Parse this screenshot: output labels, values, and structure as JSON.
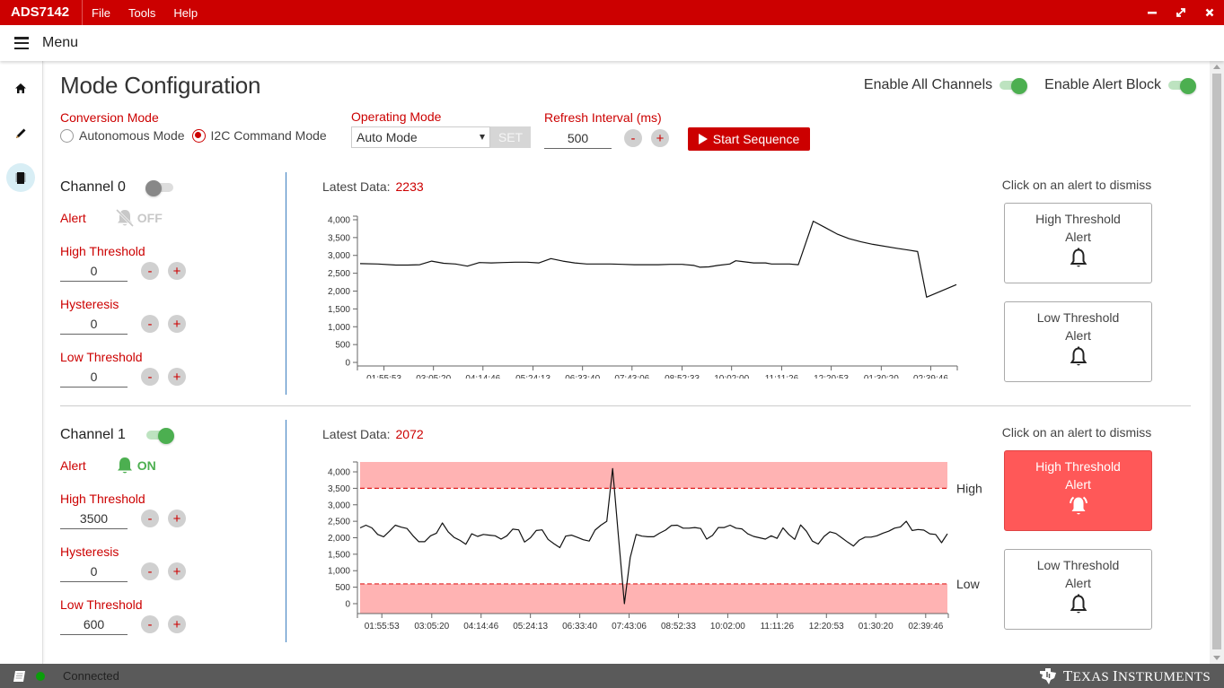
{
  "window": {
    "app_name": "ADS7142",
    "menus": [
      "File",
      "Tools",
      "Help"
    ],
    "controls": {
      "minimize": "minimize-icon",
      "maximize": "maximize-icon",
      "close": "close-icon"
    }
  },
  "menubar": {
    "label": "Menu"
  },
  "sidenav": {
    "items": [
      {
        "icon": "home-icon",
        "active": false
      },
      {
        "icon": "pencil-icon",
        "active": false
      },
      {
        "icon": "chip-icon",
        "active": true
      }
    ]
  },
  "page": {
    "title": "Mode Configuration",
    "enable_all_channels": {
      "label": "Enable All Channels",
      "on": true
    },
    "enable_alert_block": {
      "label": "Enable Alert Block",
      "on": true
    },
    "conversion_mode": {
      "label": "Conversion Mode",
      "options": [
        "Autonomous Mode",
        "I2C Command Mode"
      ],
      "selected": "I2C Command Mode"
    },
    "operating_mode": {
      "label": "Operating Mode",
      "value": "Auto Mode",
      "set_label": "SET"
    },
    "refresh_interval": {
      "label": "Refresh Interval (ms)",
      "value": "500",
      "minus": "-",
      "plus": "+"
    },
    "start_sequence_label": "Start Sequence"
  },
  "channels": [
    {
      "title": "Channel 0",
      "enabled": false,
      "alert_label": "Alert",
      "alert_state": "OFF",
      "high_threshold": {
        "label": "High Threshold",
        "value": "0"
      },
      "hysteresis": {
        "label": "Hysteresis",
        "value": "0"
      },
      "low_threshold": {
        "label": "Low Threshold",
        "value": "0"
      },
      "latest_label": "Latest Data:",
      "latest_value": "2233",
      "alerts_hint": "Click on an alert to dismiss",
      "alerts": [
        {
          "line1": "High Threshold",
          "line2": "Alert",
          "active": false
        },
        {
          "line1": "Low Threshold",
          "line2": "Alert",
          "active": false
        }
      ]
    },
    {
      "title": "Channel 1",
      "enabled": true,
      "alert_label": "Alert",
      "alert_state": "ON",
      "high_threshold": {
        "label": "High Threshold",
        "value": "3500"
      },
      "hysteresis": {
        "label": "Hysteresis",
        "value": "0"
      },
      "low_threshold": {
        "label": "Low Threshold",
        "value": "600"
      },
      "latest_label": "Latest Data:",
      "latest_value": "2072",
      "alerts_hint": "Click on an alert to dismiss",
      "alerts": [
        {
          "line1": "High Threshold",
          "line2": "Alert",
          "active": true
        },
        {
          "line1": "Low Threshold",
          "line2": "Alert",
          "active": false
        }
      ]
    }
  ],
  "pm_minus": "-",
  "pm_plus": "+",
  "status": {
    "text": "Connected",
    "color": "#0a9e0a"
  },
  "footer": {
    "brand_1": "T",
    "brand_2": "EXAS ",
    "brand_3": "I",
    "brand_4": "NSTRUMENTS"
  },
  "colors": {
    "brand_red": "#cc0000",
    "toggle_green": "#4caf50",
    "alert_active": "#ff5858",
    "band_fill": "#ffb3b3"
  },
  "chart_data": [
    {
      "type": "line",
      "title": "Channel 0",
      "xlabel": "",
      "ylabel": "",
      "ylim": [
        -100,
        4100
      ],
      "yticks": [
        0,
        500,
        1000,
        1500,
        2000,
        2500,
        3000,
        3500,
        4000
      ],
      "ytick_labels": [
        "0",
        "500",
        "1,000",
        "1,500",
        "2,000",
        "2,500",
        "3,000",
        "3,500",
        "4,000"
      ],
      "xtick_labels": [
        "01:55:53",
        "03:05:20",
        "04:14:46",
        "05:24:13",
        "06:33:40",
        "07:43:06",
        "08:52:33",
        "10:02:00",
        "11:11:26",
        "12:20:53",
        "01:30:20",
        "02:39:46"
      ],
      "x_range": [
        0,
        100
      ],
      "xtick_positions": [
        4,
        12.3,
        20.6,
        29,
        37.3,
        45.6,
        54,
        62.3,
        70.7,
        79,
        87.4,
        95.7
      ],
      "series": [
        {
          "name": "Channel 0",
          "x": [
            0,
            3,
            6,
            8,
            10,
            12,
            14,
            16,
            18,
            20,
            22,
            24,
            26,
            28,
            30,
            32,
            34,
            36,
            38,
            40,
            42,
            44,
            46,
            48,
            50,
            52,
            54,
            56,
            57,
            58.5,
            60,
            62,
            63,
            64,
            66,
            68,
            69,
            72,
            73.5,
            76,
            78,
            80,
            82,
            84,
            86,
            90,
            92,
            93.5,
            95,
            100
          ],
          "values": [
            2770,
            2760,
            2730,
            2730,
            2740,
            2840,
            2780,
            2760,
            2700,
            2800,
            2790,
            2800,
            2810,
            2810,
            2790,
            2910,
            2840,
            2790,
            2760,
            2760,
            2760,
            2750,
            2740,
            2740,
            2740,
            2750,
            2750,
            2720,
            2670,
            2680,
            2720,
            2760,
            2850,
            2830,
            2790,
            2790,
            2760,
            2760,
            2740,
            3960,
            3780,
            3600,
            3470,
            3380,
            3310,
            3200,
            3150,
            3110,
            1830,
            2180
          ]
        }
      ],
      "thresholds": null
    },
    {
      "type": "line",
      "title": "Channel 1",
      "xlabel": "",
      "ylabel": "",
      "ylim": [
        -300,
        4300
      ],
      "yticks": [
        0,
        500,
        1000,
        1500,
        2000,
        2500,
        3000,
        3500,
        4000
      ],
      "ytick_labels": [
        "0",
        "500",
        "1,000",
        "1,500",
        "2,000",
        "2,500",
        "3,000",
        "3,500",
        "4,000"
      ],
      "xtick_labels": [
        "01:55:53",
        "03:05:20",
        "04:14:46",
        "05:24:13",
        "06:33:40",
        "07:43:06",
        "08:52:33",
        "10:02:00",
        "11:11:26",
        "12:20:53",
        "01:30:20",
        "02:39:46"
      ],
      "x_range": [
        0,
        100
      ],
      "xtick_positions": [
        3.7,
        12.2,
        20.6,
        29,
        37.4,
        45.8,
        54.2,
        62.6,
        71,
        79.4,
        87.8,
        96.3
      ],
      "series": [
        {
          "name": "Channel 1",
          "x": [
            0,
            1,
            2,
            3,
            4,
            5,
            6,
            7,
            8,
            9,
            10,
            11,
            12,
            13,
            14,
            15,
            16,
            17,
            18,
            19,
            20,
            21,
            22,
            23,
            24,
            25,
            26,
            27,
            28,
            29,
            30,
            31,
            32,
            33,
            34,
            35,
            36,
            37,
            38,
            39,
            40,
            41,
            42,
            43,
            44,
            45,
            46,
            47,
            48,
            49,
            50,
            51,
            52,
            53,
            54,
            55,
            56,
            57,
            58,
            59,
            60,
            61,
            62,
            63,
            64,
            65,
            66,
            67,
            68,
            69,
            70,
            71,
            72,
            73,
            74,
            75,
            76,
            77,
            78,
            79,
            80,
            81,
            82,
            83,
            84,
            85,
            86,
            87,
            88,
            89,
            90,
            91,
            92,
            93,
            94,
            95,
            96,
            97,
            98,
            99,
            100
          ],
          "values": [
            2300,
            2380,
            2300,
            2100,
            2030,
            2200,
            2380,
            2320,
            2280,
            2060,
            1880,
            1880,
            2060,
            2140,
            2450,
            2180,
            2010,
            1920,
            1800,
            2120,
            2040,
            2100,
            2080,
            2060,
            1960,
            2060,
            2260,
            2240,
            1870,
            2000,
            2220,
            2240,
            1950,
            1820,
            1700,
            2050,
            2080,
            2010,
            1940,
            1900,
            2230,
            2380,
            2500,
            4100,
            2000,
            0,
            1400,
            2100,
            2050,
            2030,
            2030,
            2140,
            2230,
            2370,
            2380,
            2290,
            2290,
            2310,
            2280,
            1960,
            2070,
            2310,
            2310,
            2380,
            2290,
            2270,
            2120,
            2040,
            2000,
            1960,
            2060,
            1980,
            2300,
            2100,
            1950,
            2390,
            2200,
            1900,
            1810,
            2040,
            2180,
            2130,
            2000,
            1870,
            1750,
            1930,
            2020,
            2020,
            2060,
            2140,
            2200,
            2290,
            2330,
            2500,
            2220,
            2250,
            2230,
            2120,
            2100,
            1850,
            2120
          ]
        }
      ],
      "thresholds": {
        "high": 3500,
        "low": 600,
        "high_label": "High",
        "low_label": "Low"
      }
    }
  ]
}
